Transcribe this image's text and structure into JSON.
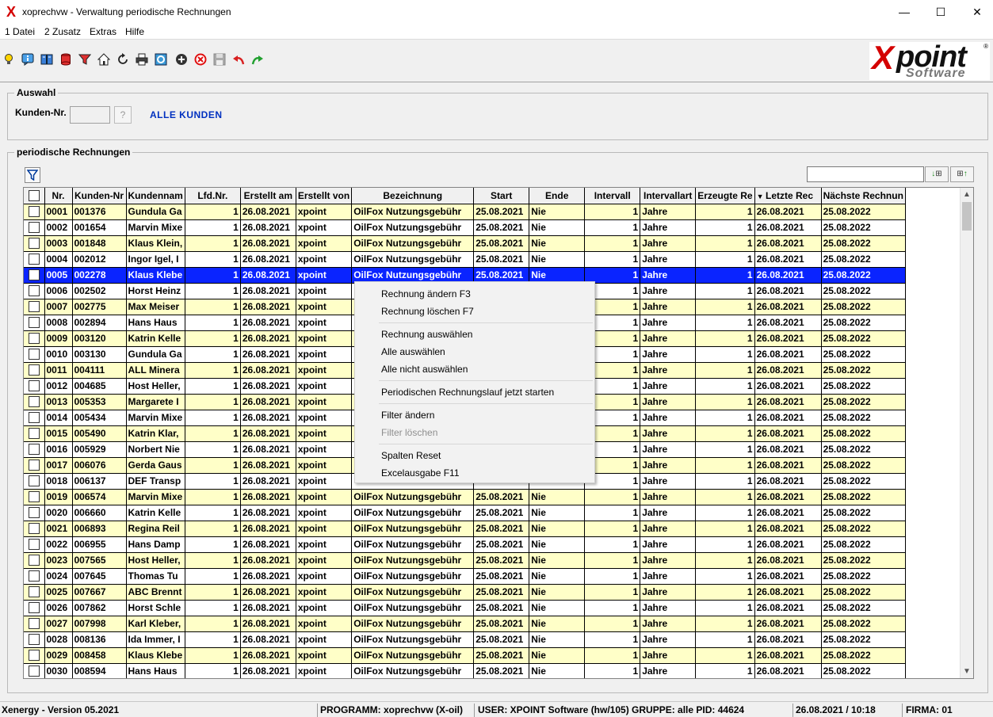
{
  "window": {
    "title": "xoprechvw - Verwaltung periodische Rechnungen",
    "minimize": "—",
    "maximize": "☐",
    "close": "✕"
  },
  "menu": [
    "1 Datei",
    "2 Zusatz",
    "Extras",
    "Hilfe"
  ],
  "toolbar_icons": [
    "lightbulb-icon",
    "info-icon",
    "book-icon",
    "database-icon",
    "filter-icon",
    "home-icon",
    "refresh-icon",
    "print-icon",
    "help-icon",
    "add-icon",
    "delete-icon",
    "save-icon",
    "undo-icon",
    "redo-icon"
  ],
  "logo": {
    "x": "X",
    "point": "point",
    "software": "Software",
    "reg": "®"
  },
  "auswahl": {
    "title": "Auswahl",
    "kunden_label": "Kunden-Nr.",
    "lookup": "?",
    "alle_kunden": "ALLE KUNDEN"
  },
  "periodische": {
    "title": "periodische Rechnungen"
  },
  "columns": [
    "Nr.",
    "Kunden-Nr",
    "Kundennam",
    "Lfd.Nr.",
    "Erstellt am",
    "Erstellt von",
    "Bezeichnung",
    "Start",
    "Ende",
    "Intervall",
    "Intervallart",
    "Erzeugte Re",
    "Letzte Rec",
    "Nächste Rechnun"
  ],
  "rows": [
    [
      "0001",
      "001376",
      "Gundula Ga",
      "1",
      "26.08.2021",
      "xpoint",
      "OilFox Nutzungsgebühr",
      "25.08.2021",
      "Nie",
      "1",
      "Jahre",
      "1",
      "26.08.2021",
      "25.08.2022"
    ],
    [
      "0002",
      "001654",
      "Marvin Mixe",
      "1",
      "26.08.2021",
      "xpoint",
      "OilFox Nutzungsgebühr",
      "25.08.2021",
      "Nie",
      "1",
      "Jahre",
      "1",
      "26.08.2021",
      "25.08.2022"
    ],
    [
      "0003",
      "001848",
      "Klaus Klein,",
      "1",
      "26.08.2021",
      "xpoint",
      "OilFox Nutzungsgebühr",
      "25.08.2021",
      "Nie",
      "1",
      "Jahre",
      "1",
      "26.08.2021",
      "25.08.2022"
    ],
    [
      "0004",
      "002012",
      "Ingor Igel, I",
      "1",
      "26.08.2021",
      "xpoint",
      "OilFox Nutzungsgebühr",
      "25.08.2021",
      "Nie",
      "1",
      "Jahre",
      "1",
      "26.08.2021",
      "25.08.2022"
    ],
    [
      "0005",
      "002278",
      "Klaus Klebe",
      "1",
      "26.08.2021",
      "xpoint",
      "OilFox Nutzungsgebühr",
      "25.08.2021",
      "Nie",
      "1",
      "Jahre",
      "1",
      "26.08.2021",
      "25.08.2022"
    ],
    [
      "0006",
      "002502",
      "Horst Heinz",
      "1",
      "26.08.2021",
      "xpoint",
      "",
      "",
      "",
      "1",
      "Jahre",
      "1",
      "26.08.2021",
      "25.08.2022"
    ],
    [
      "0007",
      "002775",
      "Max Meiser",
      "1",
      "26.08.2021",
      "xpoint",
      "",
      "",
      "",
      "1",
      "Jahre",
      "1",
      "26.08.2021",
      "25.08.2022"
    ],
    [
      "0008",
      "002894",
      "Hans Haus",
      "1",
      "26.08.2021",
      "xpoint",
      "",
      "",
      "",
      "1",
      "Jahre",
      "1",
      "26.08.2021",
      "25.08.2022"
    ],
    [
      "0009",
      "003120",
      "Katrin Kelle",
      "1",
      "26.08.2021",
      "xpoint",
      "",
      "",
      "",
      "1",
      "Jahre",
      "1",
      "26.08.2021",
      "25.08.2022"
    ],
    [
      "0010",
      "003130",
      "Gundula Ga",
      "1",
      "26.08.2021",
      "xpoint",
      "",
      "",
      "",
      "1",
      "Jahre",
      "1",
      "26.08.2021",
      "25.08.2022"
    ],
    [
      "0011",
      "004111",
      "ALL Minera",
      "1",
      "26.08.2021",
      "xpoint",
      "",
      "",
      "",
      "1",
      "Jahre",
      "1",
      "26.08.2021",
      "25.08.2022"
    ],
    [
      "0012",
      "004685",
      "Host Heller,",
      "1",
      "26.08.2021",
      "xpoint",
      "",
      "",
      "",
      "1",
      "Jahre",
      "1",
      "26.08.2021",
      "25.08.2022"
    ],
    [
      "0013",
      "005353",
      "Margarete I",
      "1",
      "26.08.2021",
      "xpoint",
      "",
      "",
      "",
      "1",
      "Jahre",
      "1",
      "26.08.2021",
      "25.08.2022"
    ],
    [
      "0014",
      "005434",
      "Marvin Mixe",
      "1",
      "26.08.2021",
      "xpoint",
      "",
      "",
      "",
      "1",
      "Jahre",
      "1",
      "26.08.2021",
      "25.08.2022"
    ],
    [
      "0015",
      "005490",
      "Katrin Klar,",
      "1",
      "26.08.2021",
      "xpoint",
      "",
      "",
      "",
      "1",
      "Jahre",
      "1",
      "26.08.2021",
      "25.08.2022"
    ],
    [
      "0016",
      "005929",
      "Norbert Nie",
      "1",
      "26.08.2021",
      "xpoint",
      "",
      "",
      "",
      "1",
      "Jahre",
      "1",
      "26.08.2021",
      "25.08.2022"
    ],
    [
      "0017",
      "006076",
      "Gerda Gaus",
      "1",
      "26.08.2021",
      "xpoint",
      "",
      "",
      "",
      "1",
      "Jahre",
      "1",
      "26.08.2021",
      "25.08.2022"
    ],
    [
      "0018",
      "006137",
      "DEF Transp",
      "1",
      "26.08.2021",
      "xpoint",
      "",
      "",
      "",
      "1",
      "Jahre",
      "1",
      "26.08.2021",
      "25.08.2022"
    ],
    [
      "0019",
      "006574",
      "Marvin Mixe",
      "1",
      "26.08.2021",
      "xpoint",
      "OilFox Nutzungsgebühr",
      "25.08.2021",
      "Nie",
      "1",
      "Jahre",
      "1",
      "26.08.2021",
      "25.08.2022"
    ],
    [
      "0020",
      "006660",
      "Katrin Kelle",
      "1",
      "26.08.2021",
      "xpoint",
      "OilFox Nutzungsgebühr",
      "25.08.2021",
      "Nie",
      "1",
      "Jahre",
      "1",
      "26.08.2021",
      "25.08.2022"
    ],
    [
      "0021",
      "006893",
      "Regina Reil",
      "1",
      "26.08.2021",
      "xpoint",
      "OilFox Nutzungsgebühr",
      "25.08.2021",
      "Nie",
      "1",
      "Jahre",
      "1",
      "26.08.2021",
      "25.08.2022"
    ],
    [
      "0022",
      "006955",
      "Hans Damp",
      "1",
      "26.08.2021",
      "xpoint",
      "OilFox Nutzungsgebühr",
      "25.08.2021",
      "Nie",
      "1",
      "Jahre",
      "1",
      "26.08.2021",
      "25.08.2022"
    ],
    [
      "0023",
      "007565",
      "Host Heller,",
      "1",
      "26.08.2021",
      "xpoint",
      "OilFox Nutzungsgebühr",
      "25.08.2021",
      "Nie",
      "1",
      "Jahre",
      "1",
      "26.08.2021",
      "25.08.2022"
    ],
    [
      "0024",
      "007645",
      "Thomas Tu",
      "1",
      "26.08.2021",
      "xpoint",
      "OilFox Nutzungsgebühr",
      "25.08.2021",
      "Nie",
      "1",
      "Jahre",
      "1",
      "26.08.2021",
      "25.08.2022"
    ],
    [
      "0025",
      "007667",
      "ABC Brennt",
      "1",
      "26.08.2021",
      "xpoint",
      "OilFox Nutzungsgebühr",
      "25.08.2021",
      "Nie",
      "1",
      "Jahre",
      "1",
      "26.08.2021",
      "25.08.2022"
    ],
    [
      "0026",
      "007862",
      "Horst Schle",
      "1",
      "26.08.2021",
      "xpoint",
      "OilFox Nutzungsgebühr",
      "25.08.2021",
      "Nie",
      "1",
      "Jahre",
      "1",
      "26.08.2021",
      "25.08.2022"
    ],
    [
      "0027",
      "007998",
      "Karl Kleber,",
      "1",
      "26.08.2021",
      "xpoint",
      "OilFox Nutzungsgebühr",
      "25.08.2021",
      "Nie",
      "1",
      "Jahre",
      "1",
      "26.08.2021",
      "25.08.2022"
    ],
    [
      "0028",
      "008136",
      "Ida Immer, I",
      "1",
      "26.08.2021",
      "xpoint",
      "OilFox Nutzungsgebühr",
      "25.08.2021",
      "Nie",
      "1",
      "Jahre",
      "1",
      "26.08.2021",
      "25.08.2022"
    ],
    [
      "0029",
      "008458",
      "Klaus Klebe",
      "1",
      "26.08.2021",
      "xpoint",
      "OilFox Nutzungsgebühr",
      "25.08.2021",
      "Nie",
      "1",
      "Jahre",
      "1",
      "26.08.2021",
      "25.08.2022"
    ],
    [
      "0030",
      "008594",
      "Hans Haus",
      "1",
      "26.08.2021",
      "xpoint",
      "OilFox Nutzungsgebühr",
      "25.08.2021",
      "Nie",
      "1",
      "Jahre",
      "1",
      "26.08.2021",
      "25.08.2022"
    ]
  ],
  "context_menu": {
    "change": "Rechnung ändern F3",
    "delete": "Rechnung löschen F7",
    "select": "Rechnung auswählen",
    "select_all": "Alle auswählen",
    "select_none": "Alle nicht auswählen",
    "run": "Periodischen Rechnungslauf jetzt starten",
    "filter_change": "Filter ändern",
    "filter_delete": "Filter löschen",
    "reset_columns": "Spalten Reset",
    "excel": "Excelausgabe F11"
  },
  "status": {
    "version": "Xenergy - Version 05.2021",
    "program": "PROGRAMM: xoprechvw (X-oil)",
    "user": "USER: XPOINT Software (hw/105)  GRUPPE: alle  PID: 44624",
    "datetime": "26.08.2021 / 10:18",
    "firma": "FIRMA: 01"
  },
  "colors": {
    "row_odd": "#ffffc8",
    "row_even": "#ffffff",
    "row_selected": "#0a24ff",
    "link_blue": "#0030c0",
    "logo_red": "#d40000"
  }
}
